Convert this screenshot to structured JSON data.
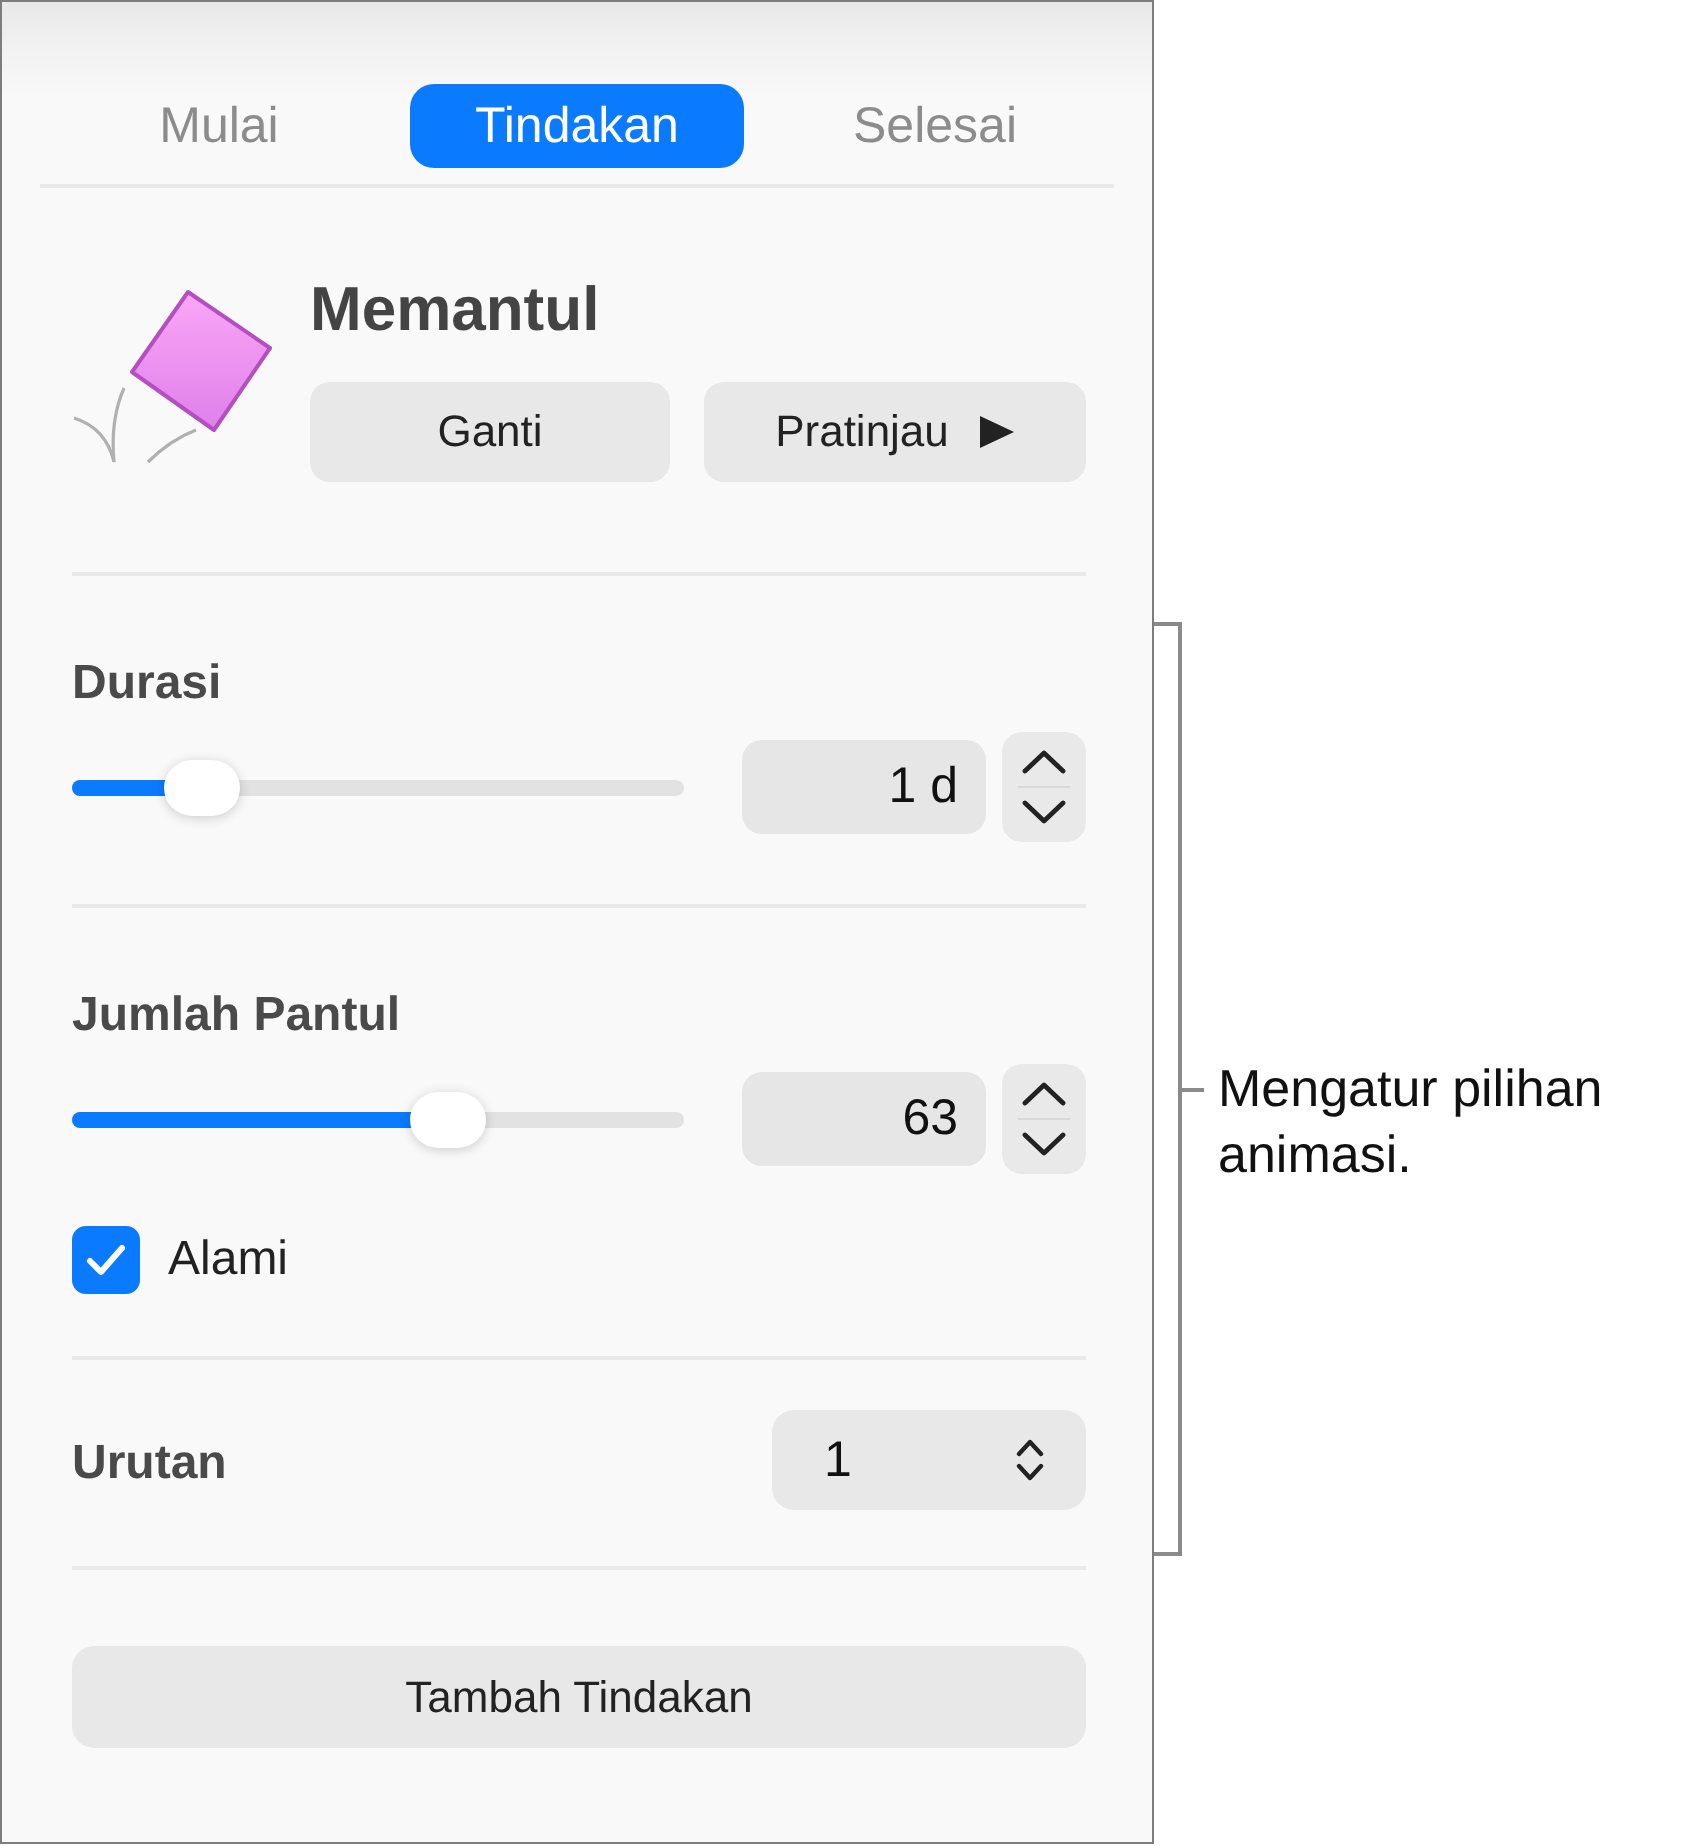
{
  "tabs": [
    {
      "label": "Mulai",
      "selected": false
    },
    {
      "label": "Tindakan",
      "selected": true
    },
    {
      "label": "Selesai",
      "selected": false
    }
  ],
  "effect": {
    "title": "Memantul",
    "buttons": [
      {
        "label": "Ganti",
        "kind": "change"
      },
      {
        "label": "Pratinjau",
        "kind": "preview"
      }
    ]
  },
  "settings": [
    {
      "kind": "slider",
      "label": "Durasi",
      "level": 0.17,
      "value": "1 d"
    },
    {
      "kind": "slider",
      "label": "Jumlah Pantul",
      "level": 0.63,
      "value": "63",
      "checkbox": {
        "label": "Alami",
        "checked": true
      }
    },
    {
      "kind": "popup",
      "label": "Urutan",
      "value": "1"
    }
  ],
  "add_button": {
    "label": "Tambah Tindakan"
  },
  "callout": {
    "text": "Mengatur pilihan animasi."
  }
}
